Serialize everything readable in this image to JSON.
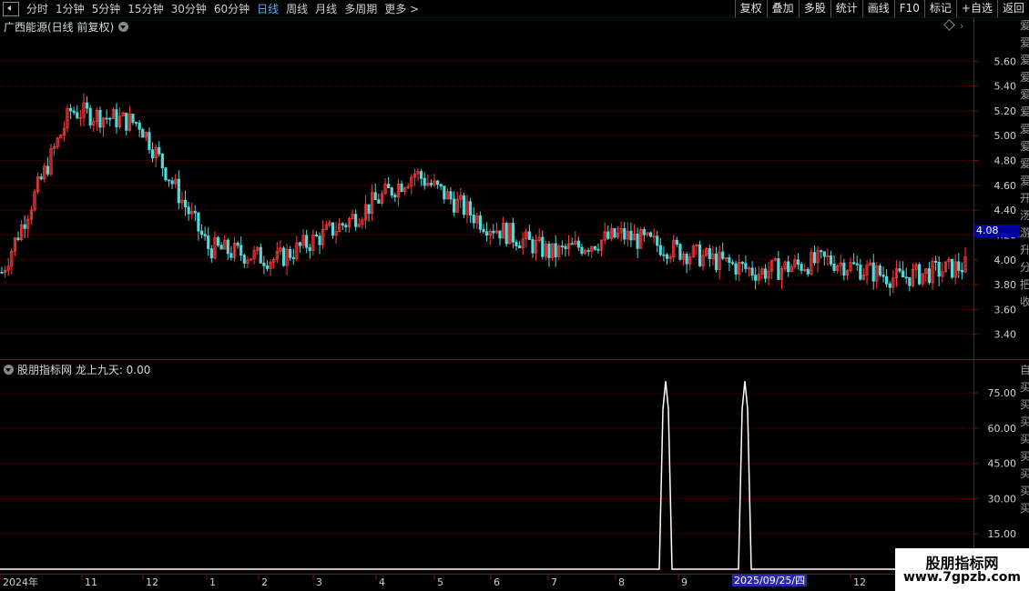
{
  "toolbar": {
    "periods": [
      "分时",
      "1分钟",
      "5分钟",
      "15分钟",
      "30分钟",
      "60分钟",
      "日线",
      "周线",
      "月线",
      "多周期",
      "更多 >"
    ],
    "active_period": "日线",
    "buttons": [
      "复权",
      "叠加",
      "多股",
      "统计",
      "画线",
      "F10",
      "标记",
      "+自选",
      "返回"
    ]
  },
  "main_chart": {
    "title": "广西能源(日线 前复权)",
    "current_price_tag": "4.08",
    "y_axis_ticks": [
      "5.60",
      "5.40",
      "5.20",
      "5.00",
      "4.80",
      "4.60",
      "4.40",
      "4.20",
      "4.00",
      "3.80",
      "3.60",
      "3.40"
    ],
    "colors": {
      "up": "#ff3c3c",
      "down": "#54d8d8",
      "grid": "#7a0000",
      "axis": "#a00000"
    }
  },
  "indicator": {
    "title": "股朋指标网  龙上九天: 0.00",
    "y_axis_ticks": [
      "75.00",
      "60.00",
      "45.00",
      "30.00",
      "15.00"
    ],
    "color": "#ffffff"
  },
  "x_axis": {
    "labels": [
      "2024年",
      "11",
      "12",
      "1",
      "2",
      "3",
      "4",
      "5",
      "6",
      "7",
      "8",
      "9",
      "2025/09/25/四",
      "12"
    ]
  },
  "right_strip": {
    "top_text": "爱爱爱爱爱爱爱爱爱爱开汤游升分把收",
    "bottom_text": "自买买买买买买买买"
  },
  "watermark": {
    "line1": "股朋指标网",
    "line2": "www.7gpzb.com"
  },
  "chart_data": {
    "type": "candlestick",
    "title": "广西能源(日线 前复权)",
    "price_range": [
      3.2,
      5.8
    ],
    "last_price": 4.08,
    "approx_closes_by_month": [
      {
        "month": "2024-10",
        "close": 3.9
      },
      {
        "month": "2024-11",
        "close": 5.2
      },
      {
        "month": "2024-12",
        "close": 5.1
      },
      {
        "month": "2025-01",
        "close": 4.1
      },
      {
        "month": "2025-02",
        "close": 4.0
      },
      {
        "month": "2025-03",
        "close": 4.3
      },
      {
        "month": "2025-04",
        "close": 4.7
      },
      {
        "month": "2025-05",
        "close": 4.3
      },
      {
        "month": "2025-06",
        "close": 4.05
      },
      {
        "month": "2025-07",
        "close": 4.2
      },
      {
        "month": "2025-08",
        "close": 4.05
      },
      {
        "month": "2025-09",
        "close": 3.9
      },
      {
        "month": "2025-10",
        "close": 4.0
      },
      {
        "month": "2025-11",
        "close": 3.85
      },
      {
        "month": "2025-12",
        "close": 3.95
      }
    ],
    "indicator_series": {
      "name": "龙上九天",
      "peaks": [
        80,
        80
      ],
      "baseline": 0,
      "ylim": [
        0,
        80
      ]
    }
  }
}
